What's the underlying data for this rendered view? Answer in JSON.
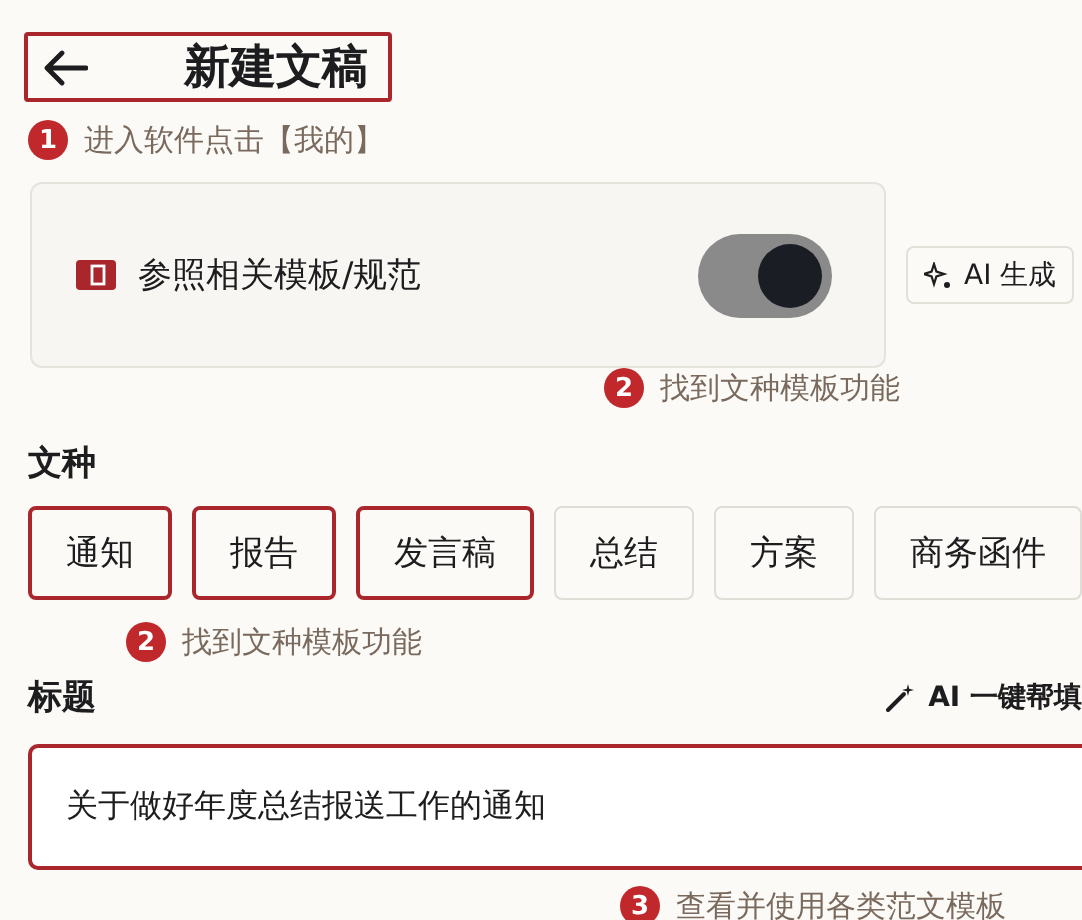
{
  "header": {
    "title": "新建文稿",
    "highlighted": true,
    "annotation": {
      "number": "1",
      "text": "进入软件点击【我的】"
    }
  },
  "template_option": {
    "label": "参照相关模板/规范",
    "on": true,
    "ai_button": "AI 生成",
    "annotation": {
      "number": "2",
      "text": "找到文种模板功能"
    }
  },
  "doc_type": {
    "label": "文种",
    "options": [
      {
        "label": "通知",
        "highlighted": true
      },
      {
        "label": "报告",
        "highlighted": true
      },
      {
        "label": "发言稿",
        "highlighted": true
      },
      {
        "label": "总结",
        "highlighted": false
      },
      {
        "label": "方案",
        "highlighted": false
      },
      {
        "label": "商务函件",
        "highlighted": false
      }
    ],
    "annotation": {
      "number": "2",
      "text": "找到文种模板功能"
    }
  },
  "title_field": {
    "label": "标题",
    "ai_fill": "AI 一键帮填",
    "value": "关于做好年度总结报送工作的通知",
    "highlighted": true,
    "annotation": {
      "number": "3",
      "text": "查看并使用各类范文模板"
    }
  }
}
